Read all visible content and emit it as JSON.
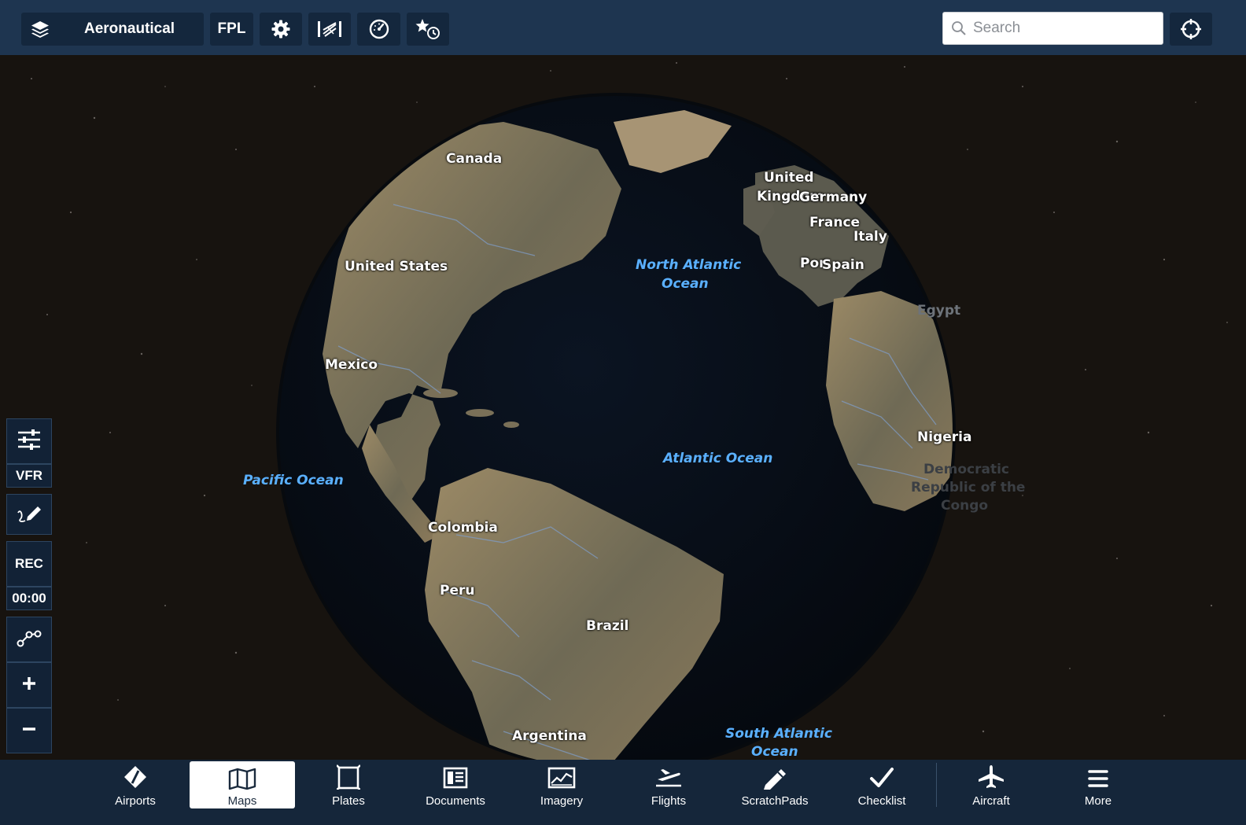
{
  "topbar": {
    "layers_label": "Aeronautical",
    "fpl_label": "FPL",
    "search_placeholder": "Search"
  },
  "map": {
    "land_labels": {
      "canada": "Canada",
      "united_states": "United States",
      "mexico": "Mexico",
      "united_kingdom_1": "United",
      "united_kingdom_2": "Kingdom",
      "germany": "Germany",
      "france": "France",
      "italy": "Italy",
      "portugal": "Por",
      "spain": "Spain",
      "egypt": "Egypt",
      "nigeria": "Nigeria",
      "drc_1": "Democratic",
      "drc_2": "Republic of the",
      "drc_3": "Congo",
      "colombia": "Colombia",
      "peru": "Peru",
      "brazil": "Brazil",
      "argentina": "Argentina"
    },
    "ocean_labels": {
      "north_atlantic_1": "North Atlantic",
      "north_atlantic_2": "Ocean",
      "atlantic": "Atlantic Ocean",
      "pacific": "Pacific Ocean",
      "south_atlantic_1": "South Atlantic",
      "south_atlantic_2": "Ocean"
    }
  },
  "left_toolbar": {
    "vfr_label": "VFR",
    "rec_label": "REC",
    "timer": "00:00"
  },
  "tabs": [
    {
      "label": "Airports",
      "icon": "airports-icon"
    },
    {
      "label": "Maps",
      "icon": "maps-icon",
      "active": true
    },
    {
      "label": "Plates",
      "icon": "plates-icon"
    },
    {
      "label": "Documents",
      "icon": "documents-icon"
    },
    {
      "label": "Imagery",
      "icon": "imagery-icon"
    },
    {
      "label": "Flights",
      "icon": "flights-icon"
    },
    {
      "label": "ScratchPads",
      "icon": "scratchpads-icon"
    },
    {
      "label": "Checklist",
      "icon": "checklist-icon"
    },
    {
      "label": "Aircraft",
      "icon": "aircraft-icon"
    },
    {
      "label": "More",
      "icon": "more-icon"
    }
  ]
}
